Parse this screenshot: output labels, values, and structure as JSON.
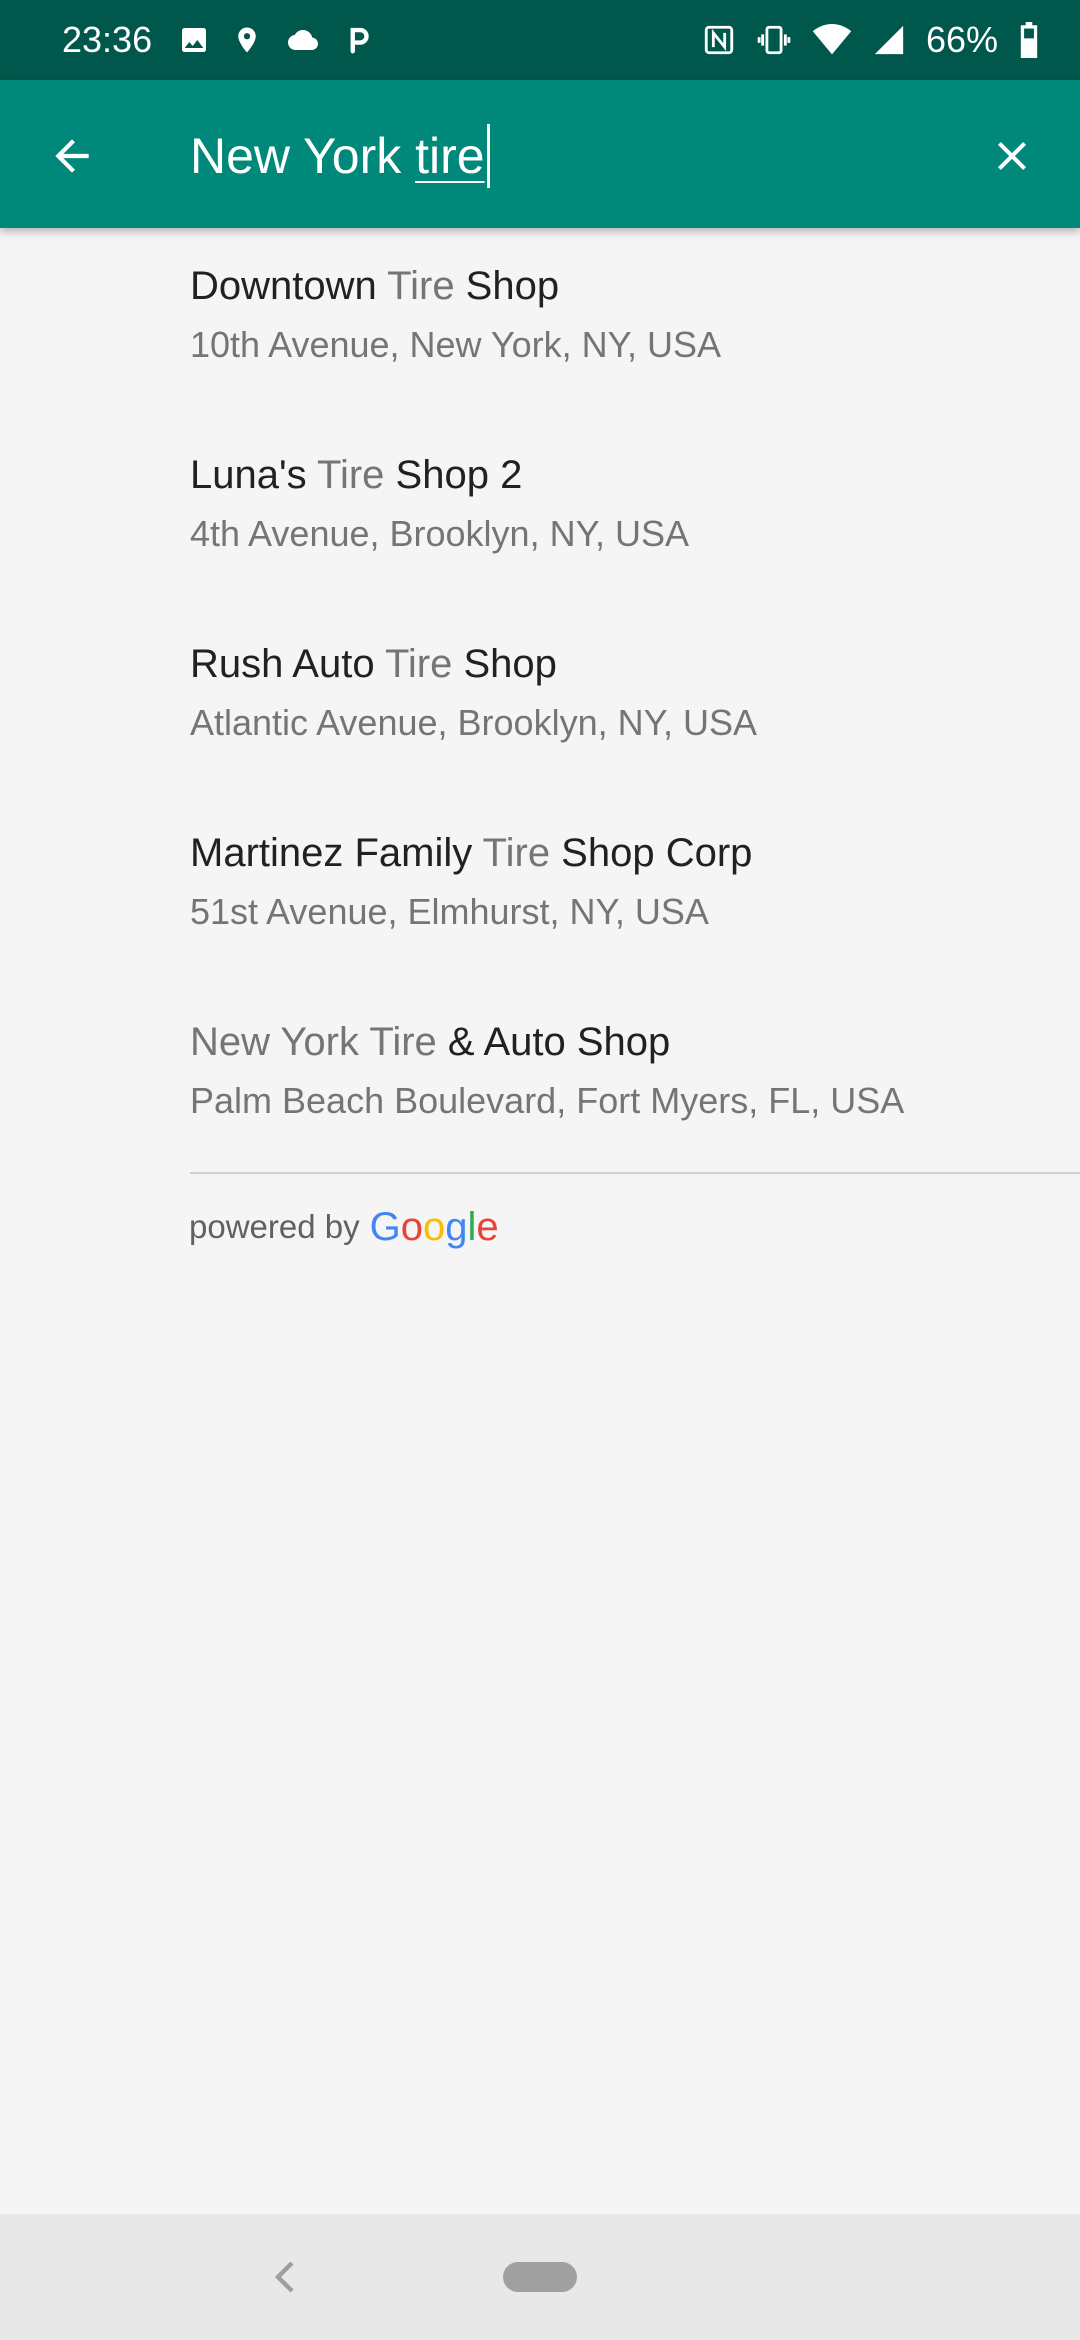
{
  "status_bar": {
    "time": "23:36",
    "battery": "66%",
    "left_icons": [
      "image-icon",
      "location-pin-icon",
      "cloud-icon",
      "parking-icon"
    ],
    "right_icons": [
      "nfc-icon",
      "vibrate-icon",
      "wifi-icon",
      "signal-icon",
      "battery-icon"
    ]
  },
  "toolbar": {
    "color": "#00897b",
    "query_prefix": "New York ",
    "query_underlined": "tire",
    "back_icon": "arrow-back-icon",
    "clear_icon": "close-icon"
  },
  "results": [
    {
      "title_parts": [
        "Downtown ",
        "Tire",
        " Shop"
      ],
      "address": "10th Avenue, New York, NY, USA"
    },
    {
      "title_parts": [
        "Luna's ",
        "Tire",
        " Shop 2"
      ],
      "address": "4th Avenue, Brooklyn, NY, USA"
    },
    {
      "title_parts": [
        "Rush Auto ",
        "Tire",
        " Shop"
      ],
      "address": "Atlantic Avenue, Brooklyn, NY, USA"
    },
    {
      "title_parts": [
        "Martinez Family ",
        "Tire",
        " Shop Corp"
      ],
      "address": "51st Avenue, Elmhurst, NY, USA"
    },
    {
      "title_parts": [
        "",
        "New York Tire",
        " & Auto Shop"
      ],
      "address": "Palm Beach Boulevard, Fort Myers, FL, USA"
    }
  ],
  "attribution": {
    "text": "powered by",
    "logo_letters": [
      {
        "ch": "G",
        "color": "#4285F4"
      },
      {
        "ch": "o",
        "color": "#EA4335"
      },
      {
        "ch": "o",
        "color": "#FBBC05"
      },
      {
        "ch": "g",
        "color": "#4285F4"
      },
      {
        "ch": "l",
        "color": "#34A853"
      },
      {
        "ch": "e",
        "color": "#EA4335"
      }
    ]
  },
  "nav_bar": {
    "back_icon": "nav-back-icon",
    "home_icon": "home-pill-icon"
  }
}
